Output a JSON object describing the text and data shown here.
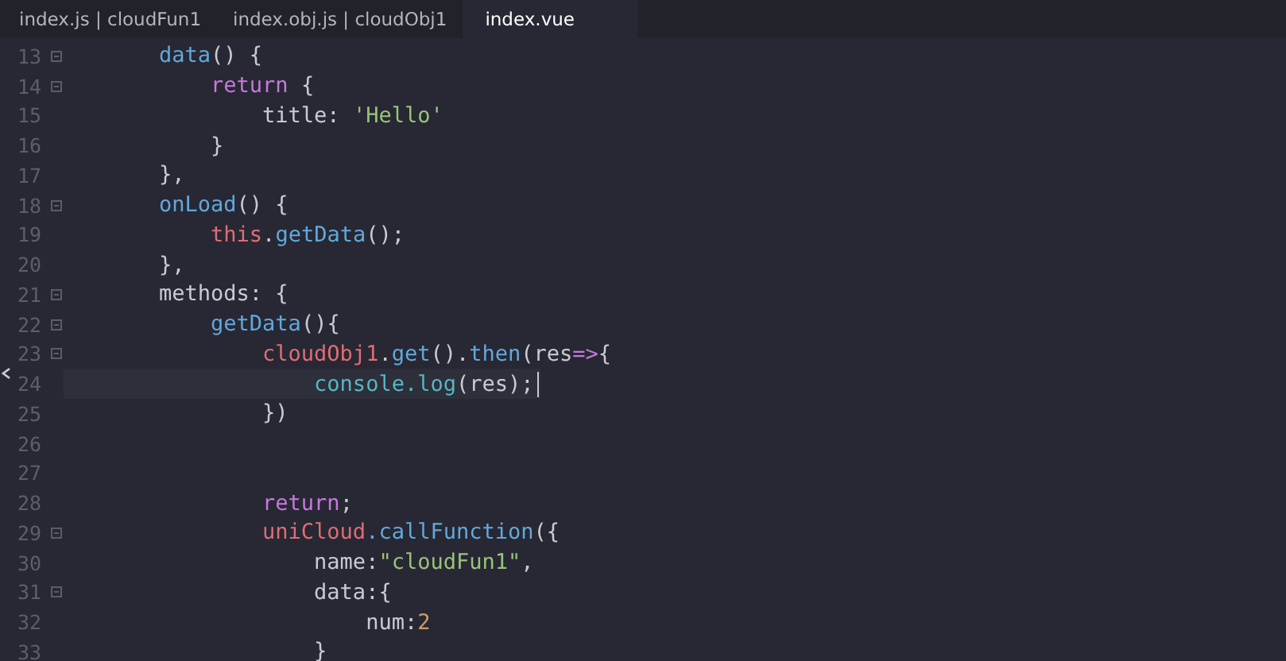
{
  "tabs": [
    {
      "label": "index.js | cloudFun1",
      "selected": false
    },
    {
      "label": "index.obj.js | cloudObj1",
      "selected": false
    },
    {
      "label": "index.vue",
      "selected": true
    }
  ],
  "lines": [
    {
      "number": "13",
      "fold": true,
      "current": false,
      "tokens": [
        {
          "kind": "fn",
          "text": "        data"
        },
        {
          "kind": "plain",
          "text": "() {"
        }
      ]
    },
    {
      "number": "14",
      "fold": true,
      "current": false,
      "tokens": [
        {
          "kind": "keyword",
          "text": "            return"
        },
        {
          "kind": "plain",
          "text": " {"
        }
      ]
    },
    {
      "number": "15",
      "fold": false,
      "current": false,
      "tokens": [
        {
          "kind": "plain",
          "text": "                title: "
        },
        {
          "kind": "string",
          "text": "'Hello'"
        }
      ]
    },
    {
      "number": "16",
      "fold": false,
      "current": false,
      "tokens": [
        {
          "kind": "plain",
          "text": "            }"
        }
      ]
    },
    {
      "number": "17",
      "fold": false,
      "current": false,
      "tokens": [
        {
          "kind": "plain",
          "text": "        },"
        }
      ]
    },
    {
      "number": "18",
      "fold": true,
      "current": false,
      "tokens": [
        {
          "kind": "fn",
          "text": "        onLoad"
        },
        {
          "kind": "plain",
          "text": "() {"
        }
      ]
    },
    {
      "number": "19",
      "fold": false,
      "current": false,
      "tokens": [
        {
          "kind": "object",
          "text": "            this"
        },
        {
          "kind": "plain",
          "text": "."
        },
        {
          "kind": "fn",
          "text": "getData"
        },
        {
          "kind": "plain",
          "text": "();"
        }
      ]
    },
    {
      "number": "20",
      "fold": false,
      "current": false,
      "tokens": [
        {
          "kind": "plain",
          "text": "        },"
        }
      ]
    },
    {
      "number": "21",
      "fold": true,
      "current": false,
      "tokens": [
        {
          "kind": "plain",
          "text": "        methods: {"
        }
      ]
    },
    {
      "number": "22",
      "fold": true,
      "current": false,
      "tokens": [
        {
          "kind": "fn",
          "text": "            getData"
        },
        {
          "kind": "plain",
          "text": "(){"
        }
      ]
    },
    {
      "number": "23",
      "fold": true,
      "current": false,
      "tokens": [
        {
          "kind": "object",
          "text": "                cloudObj1"
        },
        {
          "kind": "plain",
          "text": "."
        },
        {
          "kind": "fn",
          "text": "get"
        },
        {
          "kind": "plain",
          "text": "()."
        },
        {
          "kind": "fn",
          "text": "then"
        },
        {
          "kind": "plain",
          "text": "(res"
        },
        {
          "kind": "keyword",
          "text": "=>"
        },
        {
          "kind": "plain",
          "text": "{"
        }
      ]
    },
    {
      "number": "24",
      "fold": false,
      "current": true,
      "tokens": [
        {
          "kind": "builtin",
          "text": "                    console.log"
        },
        {
          "kind": "plain",
          "text": "(res);"
        }
      ]
    },
    {
      "number": "25",
      "fold": false,
      "current": false,
      "tokens": [
        {
          "kind": "plain",
          "text": "                })"
        }
      ]
    },
    {
      "number": "26",
      "fold": false,
      "current": false
    },
    {
      "number": "27",
      "fold": false,
      "current": false
    },
    {
      "number": "28",
      "fold": false,
      "current": false,
      "tokens": [
        {
          "kind": "keyword",
          "text": "                return"
        },
        {
          "kind": "plain",
          "text": ";"
        }
      ]
    },
    {
      "number": "29",
      "fold": true,
      "current": false,
      "tokens": [
        {
          "kind": "object",
          "text": "                uniCloud"
        },
        {
          "kind": "fn",
          "text": ".callFunction"
        },
        {
          "kind": "plain",
          "text": "({"
        }
      ]
    },
    {
      "number": "30",
      "fold": false,
      "current": false,
      "tokens": [
        {
          "kind": "plain",
          "text": "                    name:"
        },
        {
          "kind": "string",
          "text": "\"cloudFun1\""
        },
        {
          "kind": "plain",
          "text": ","
        }
      ]
    },
    {
      "number": "31",
      "fold": true,
      "current": false,
      "tokens": [
        {
          "kind": "plain",
          "text": "                    data:{"
        }
      ]
    },
    {
      "number": "32",
      "fold": false,
      "current": false,
      "tokens": [
        {
          "kind": "plain",
          "text": "                        num:"
        },
        {
          "kind": "number",
          "text": "2"
        }
      ]
    },
    {
      "number": "33",
      "fold": false,
      "current": false,
      "tokens": [
        {
          "kind": "plain",
          "text": "                    }"
        }
      ]
    }
  ]
}
